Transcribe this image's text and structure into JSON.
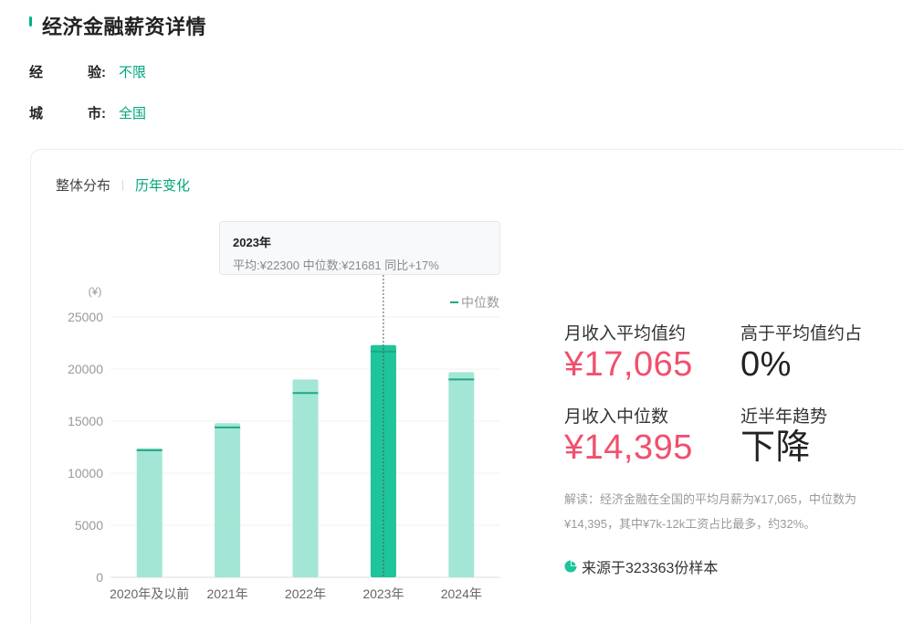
{
  "page": {
    "title": "经济金融薪资详情"
  },
  "filters": [
    {
      "label_c1": "经",
      "label_c2": "验:",
      "value": "不限"
    },
    {
      "label_c1": "城",
      "label_c2": "市:",
      "value": "全国"
    }
  ],
  "tabs": [
    {
      "label": "整体分布",
      "active": false
    },
    {
      "label": "历年变化",
      "active": true
    }
  ],
  "tooltip": {
    "title": "2023年",
    "body": "平均:¥22300  中位数:¥21681  同比+17%"
  },
  "chart_data": {
    "type": "bar",
    "unit_label": "(¥)",
    "legend": "中位数",
    "categories": [
      "2020年及以前",
      "2021年",
      "2022年",
      "2023年",
      "2024年"
    ],
    "series": [
      {
        "name": "",
        "values": [
          12400,
          14800,
          19000,
          22300,
          19700
        ]
      },
      {
        "name": "中位数",
        "values": [
          12200,
          14400,
          17700,
          21681,
          19000
        ]
      }
    ],
    "yticks": [
      "0",
      "5000",
      "10000",
      "15000",
      "20000",
      "25000"
    ],
    "ylim": [
      0,
      25000
    ],
    "highlight_index": 3,
    "colors": {
      "bar": "#a3e6d6",
      "bar_highlight": "#1ec49a",
      "median": "#20a983"
    }
  },
  "stats": {
    "avg_label": "月收入平均值约",
    "avg_value": "¥17,065",
    "above_label": "高于平均值约占",
    "above_value": "0%",
    "median_label": "月收入中位数",
    "median_value": "¥14,395",
    "trend_label": "近半年趋势",
    "trend_value": "下降"
  },
  "explain": "解读：经济金融在全国的平均月薪为¥17,065，中位数为¥14,395，其中¥7k-12k工资占比最多，约32%。",
  "source": "来源于323363份样本"
}
